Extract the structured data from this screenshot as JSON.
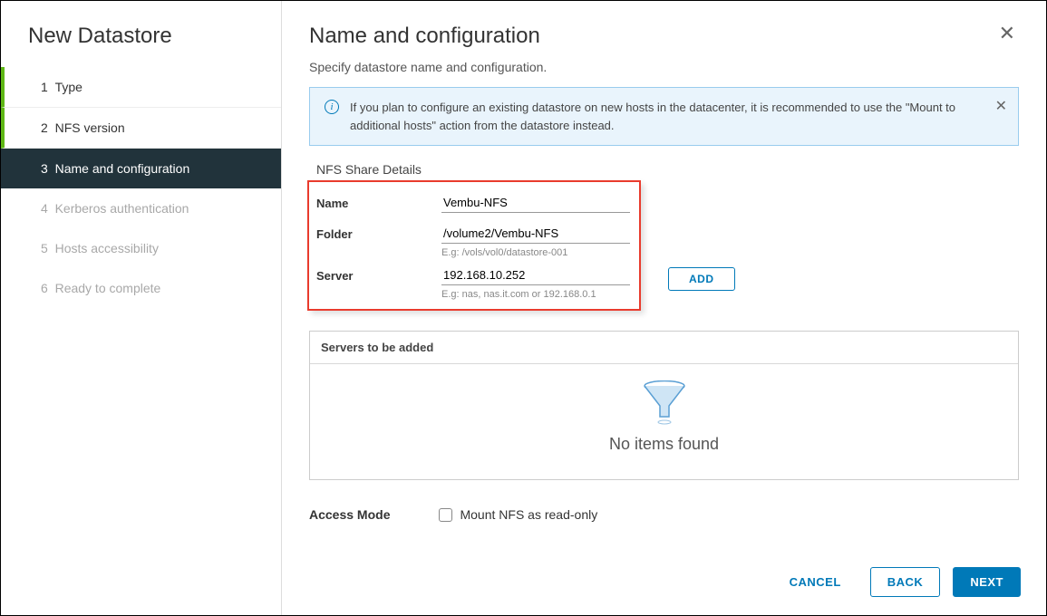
{
  "sidebar": {
    "title": "New Datastore",
    "steps": [
      {
        "num": "1",
        "label": "Type",
        "state": "done"
      },
      {
        "num": "2",
        "label": "NFS version",
        "state": "done"
      },
      {
        "num": "3",
        "label": "Name and configuration",
        "state": "active"
      },
      {
        "num": "4",
        "label": "Kerberos authentication",
        "state": "disabled"
      },
      {
        "num": "5",
        "label": "Hosts accessibility",
        "state": "disabled"
      },
      {
        "num": "6",
        "label": "Ready to complete",
        "state": "disabled"
      }
    ]
  },
  "main": {
    "title": "Name and configuration",
    "subtitle": "Specify datastore name and configuration.",
    "info_text": "If you plan to configure an existing datastore on new hosts in the datacenter, it is recommended to use the \"Mount to additional hosts\" action from the datastore instead.",
    "nfs_section_label": "NFS Share Details",
    "form": {
      "name_label": "Name",
      "name_value": "Vembu-NFS",
      "folder_label": "Folder",
      "folder_value": "/volume2/Vembu-NFS",
      "folder_hint": "E.g: /vols/vol0/datastore-001",
      "server_label": "Server",
      "server_value": "192.168.10.252",
      "server_hint": "E.g: nas, nas.it.com or 192.168.0.1",
      "add_label": "ADD"
    },
    "servers": {
      "header": "Servers to be added",
      "empty_text": "No items found"
    },
    "access": {
      "label": "Access Mode",
      "checkbox_label": "Mount NFS as read-only"
    }
  },
  "footer": {
    "cancel": "CANCEL",
    "back": "BACK",
    "next": "NEXT"
  }
}
